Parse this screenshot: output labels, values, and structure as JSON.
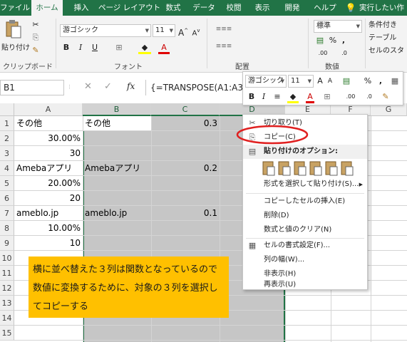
{
  "ribbon_tabs": [
    "ファイル",
    "ホーム",
    "挿入",
    "ページ レイアウト",
    "数式",
    "データ",
    "校閲",
    "表示",
    "開発",
    "ヘルプ",
    "実行したい作"
  ],
  "ribbon": {
    "paste_label": "貼り付け",
    "clipboard_label": "クリップボード",
    "font_name": "游ゴシック",
    "font_size": "11",
    "font_group_label": "フォント",
    "alignment_label": "配置",
    "number_format": "標準",
    "number_label": "数値",
    "styles": [
      "条件付き",
      "テーブル",
      "セルのスタ"
    ]
  },
  "formula_bar": {
    "name_box": "B1",
    "fx": "fx",
    "formula": "{=TRANSPOSE(A1:A3)"
  },
  "columns": [
    "A",
    "B",
    "C",
    "D",
    "E",
    "F",
    "G"
  ],
  "rows": [
    "1",
    "2",
    "3",
    "4",
    "5",
    "6",
    "7",
    "8",
    "9",
    "10",
    "11",
    "12",
    "13",
    "14",
    "15"
  ],
  "cells": {
    "a1": "その他",
    "b1": "その他",
    "c1": "0.3",
    "a2": "30.00%",
    "a3": "30",
    "a4": "Amebaアプリ",
    "b4": "Amebaアプリ",
    "c4": "0.2",
    "a5": "20.00%",
    "a6": "20",
    "a7": "ameblo.jp",
    "b7": "ameblo.jp",
    "c7": "0.1",
    "a8": "10.00%",
    "a9": "10"
  },
  "mini_toolbar": {
    "font_name": "游ゴシック",
    "font_size": "11"
  },
  "context_menu": {
    "cut": "切り取り(T)",
    "copy": "コピー(C)",
    "paste_options_header": "貼り付けのオプション:",
    "paste_special": "形式を選択して貼り付け(S)...",
    "insert_copied": "コピーしたセルの挿入(E)",
    "delete": "削除(D)",
    "clear": "数式と値のクリア(N)",
    "format_cells": "セルの書式設定(F)...",
    "column_width": "列の幅(W)...",
    "hide": "非表示(H)",
    "unhide": "再表示(U)"
  },
  "note": [
    "横に並べ替えた３列は関数となっているので",
    "数値に変換するために、対象の３列を選択し",
    "てコピーする"
  ],
  "colors": {
    "accent": "#217346",
    "highlight": "#ffc000",
    "annotation": "#e02020"
  }
}
